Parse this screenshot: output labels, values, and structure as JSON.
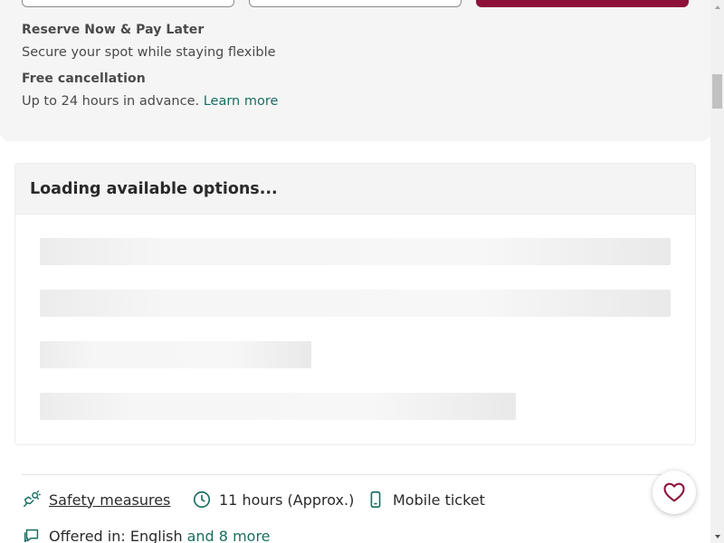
{
  "booking": {
    "reserve_title": "Reserve Now & Pay Later",
    "reserve_text": "Secure your spot while staying flexible",
    "cancel_title": "Free cancellation",
    "cancel_text": "Up to 24 hours in advance.",
    "learn_more": "Learn more"
  },
  "options": {
    "loading_title": "Loading available options..."
  },
  "features": {
    "safety": "Safety measures",
    "duration": "11 hours (Approx.)",
    "ticket": "Mobile ticket",
    "offered_prefix": "Offered in: English",
    "offered_more": "and 8 more"
  },
  "colors": {
    "accent": "#8d1239",
    "link": "#1a6e62",
    "icon": "#1a6e62",
    "heart": "#8d1239"
  },
  "icons": {
    "safety": "safety-hands-icon",
    "duration": "clock-icon",
    "ticket": "mobile-phone-icon",
    "language": "chat-bubbles-icon",
    "wishlist": "heart-icon"
  }
}
